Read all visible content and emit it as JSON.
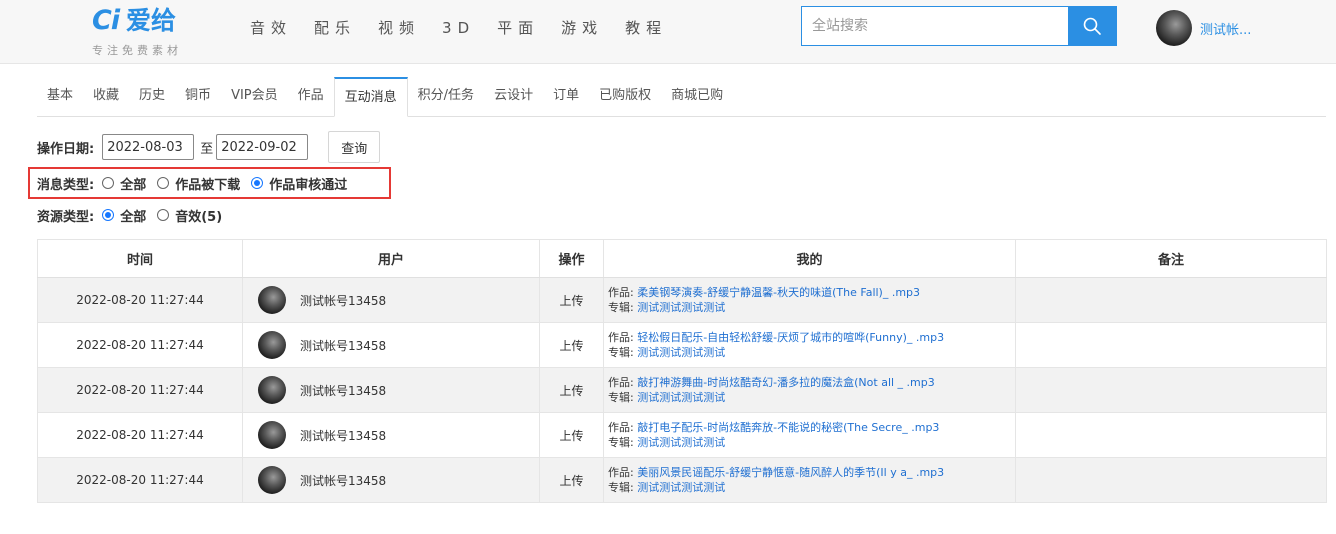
{
  "header": {
    "logo_mark": "Ci",
    "logo_name": "爱给",
    "slogan": "专注免费素材",
    "nav": [
      "音效",
      "配乐",
      "视频",
      "3D",
      "平面",
      "游戏",
      "教程"
    ],
    "search_placeholder": "全站搜索",
    "user_name": "测试帐..."
  },
  "tabs": [
    {
      "label": "基本",
      "active": false
    },
    {
      "label": "收藏",
      "active": false
    },
    {
      "label": "历史",
      "active": false
    },
    {
      "label": "铜币",
      "active": false
    },
    {
      "label": "VIP会员",
      "active": false
    },
    {
      "label": "作品",
      "active": false
    },
    {
      "label": "互动消息",
      "active": true
    },
    {
      "label": "积分/任务",
      "active": false
    },
    {
      "label": "云设计",
      "active": false
    },
    {
      "label": "订单",
      "active": false
    },
    {
      "label": "已购版权",
      "active": false
    },
    {
      "label": "商城已购",
      "active": false
    }
  ],
  "filters": {
    "date_label": "操作日期:",
    "date_from": "2022-08-03",
    "to_text": "至",
    "date_to": "2022-09-02",
    "query_label": "查询",
    "msg_type_label": "消息类型:",
    "msg_types": [
      {
        "label": "全部",
        "checked": false
      },
      {
        "label": "作品被下载",
        "checked": false
      },
      {
        "label": "作品审核通过",
        "checked": true
      }
    ],
    "res_type_label": "资源类型:",
    "res_types": [
      {
        "label": "全部",
        "checked": true
      },
      {
        "label": "音效(5)",
        "checked": false
      }
    ]
  },
  "table": {
    "headers": [
      "时间",
      "用户",
      "操作",
      "我的",
      "备注"
    ],
    "work_prefix": "作品: ",
    "album_prefix": "专辑: ",
    "rows": [
      {
        "time": "2022-08-20 11:27:44",
        "user": "测试帐号13458",
        "op": "上传",
        "work": "柔美钢琴演奏-舒缓宁静温馨-秋天的味道(The Fall)_ .mp3",
        "album": "测试测试测试测试",
        "note": ""
      },
      {
        "time": "2022-08-20 11:27:44",
        "user": "测试帐号13458",
        "op": "上传",
        "work": "轻松假日配乐-自由轻松舒缓-厌烦了城市的喧哗(Funny)_ .mp3",
        "album": "测试测试测试测试",
        "note": ""
      },
      {
        "time": "2022-08-20 11:27:44",
        "user": "测试帐号13458",
        "op": "上传",
        "work": "敲打神游舞曲-时尚炫酷奇幻-潘多拉的魔法盒(Not all _ .mp3",
        "album": "测试测试测试测试",
        "note": ""
      },
      {
        "time": "2022-08-20 11:27:44",
        "user": "测试帐号13458",
        "op": "上传",
        "work": "敲打电子配乐-时尚炫酷奔放-不能说的秘密(The Secre_ .mp3",
        "album": "测试测试测试测试",
        "note": ""
      },
      {
        "time": "2022-08-20 11:27:44",
        "user": "测试帐号13458",
        "op": "上传",
        "work": "美丽风景民谣配乐-舒缓宁静惬意-随风醉人的季节(Il y a_ .mp3",
        "album": "测试测试测试测试",
        "note": ""
      }
    ]
  },
  "colors": {
    "accent": "#2b8fe3",
    "link": "#1f6fd1",
    "highlight": "#e53935",
    "radio": "#1677ff"
  },
  "icons": {
    "search": "search-icon",
    "avatar": "avatar"
  }
}
